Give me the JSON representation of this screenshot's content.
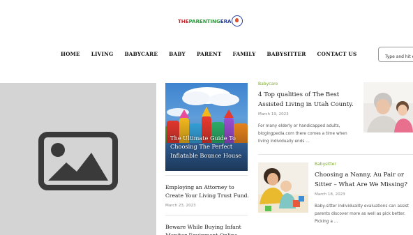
{
  "brand": {
    "part1": "THE",
    "part2": "PARENTING",
    "part3": "ERA"
  },
  "nav": [
    "HOME",
    "LIVING",
    "BABYCARE",
    "BABY",
    "PARENT",
    "FAMILY",
    "BABYSITTER",
    "CONTACT US"
  ],
  "search": {
    "placeholder": "Type and hit e"
  },
  "featured": {
    "title": "The Ultimate Guide To Choosing The Perfect Inflatable Bounce House"
  },
  "side_posts": [
    {
      "title": "Employing an Attorney to Create Your Living Trust Fund.",
      "date": "March 23, 2023"
    },
    {
      "title": "Beware While Buying Infant Monitor Equipment Online"
    }
  ],
  "posts": [
    {
      "category": "Babycare",
      "title": "4 Top qualities of The Best Assisted Living in Utah County.",
      "date": "March 19, 2023",
      "excerpt": "For many elderly or handicapped adults, blogingpedia.com there comes a time when living individually ends ..."
    },
    {
      "category": "Babysitter",
      "title": "Choosing a Nanny, Au Pair or Sitter – What Are We Missing?",
      "date": "March 18, 2023",
      "excerpt": "Baby-sitter individuality evaluations can assist parents discover more as well as pick better. Picking a ..."
    }
  ],
  "colors": {
    "category_green": "#7ba82c",
    "placeholder_gray": "#d4d4d4",
    "icon_dark": "#3a3a3a"
  }
}
